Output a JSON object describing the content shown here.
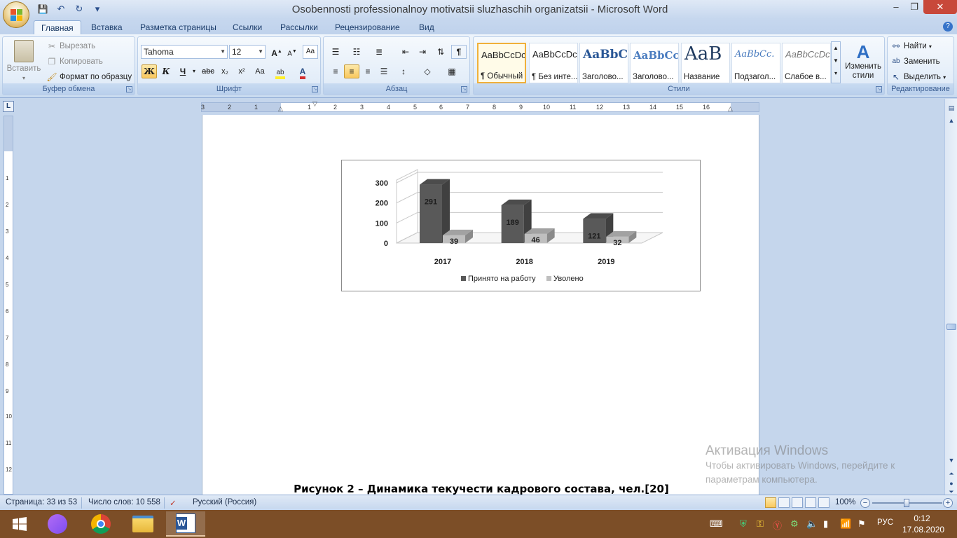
{
  "window": {
    "title": "Osobennosti professionalnoy motivatsii sluzhaschih organizatsii - Microsoft Word",
    "minimize": "‒",
    "maximize": "❐",
    "close": "✕"
  },
  "qat": {
    "save": "💾",
    "undo": "↶",
    "redo": "↻",
    "more": "▾"
  },
  "tabs": [
    "Главная",
    "Вставка",
    "Разметка страницы",
    "Ссылки",
    "Рассылки",
    "Рецензирование",
    "Вид"
  ],
  "clipboard": {
    "label": "Буфер обмена",
    "paste": "Вставить",
    "cut": "Вырезать",
    "copy": "Копировать",
    "format_painter": "Формат по образцу"
  },
  "font": {
    "label": "Шрифт",
    "family": "Tahoma",
    "size": "12",
    "bold": "Ж",
    "italic": "К",
    "underline": "Ч",
    "strike": "abc",
    "subscript": "x₂",
    "superscript": "x²",
    "case": "Aa"
  },
  "paragraph": {
    "label": "Абзац",
    "pilcrow": "¶"
  },
  "styles": {
    "label": "Стили",
    "items": [
      {
        "sample": "AaBbCcDc",
        "name": "¶ Обычный"
      },
      {
        "sample": "AaBbCcDc",
        "name": "¶ Без инте..."
      },
      {
        "sample": "AaBbC",
        "name": "Заголово..."
      },
      {
        "sample": "AaBbCc",
        "name": "Заголово..."
      },
      {
        "sample": "AaB",
        "name": "Название"
      },
      {
        "sample": "AaBbCc.",
        "name": "Подзагол..."
      },
      {
        "sample": "AaBbCcDc",
        "name": "Слабое в..."
      }
    ],
    "change": "Изменить стили"
  },
  "editing": {
    "label": "Редактирование",
    "find": "Найти",
    "replace": "Заменить",
    "select": "Выделить"
  },
  "ruler": {
    "corner": "L",
    "ticks": [
      "3",
      "2",
      "1",
      "1",
      "2",
      "3",
      "4",
      "5",
      "6",
      "7",
      "8",
      "9",
      "10",
      "11",
      "12",
      "13",
      "14",
      "15",
      "16"
    ],
    "vticks": [
      "1",
      "2",
      "3",
      "4",
      "5",
      "6",
      "7",
      "8",
      "9",
      "10",
      "11",
      "12"
    ]
  },
  "chart_data": {
    "type": "bar",
    "categories": [
      "2017",
      "2018",
      "2019"
    ],
    "series": [
      {
        "name": "Принято на работу",
        "values": [
          291,
          189,
          121
        ],
        "color": "#595959"
      },
      {
        "name": "Уволено",
        "values": [
          39,
          46,
          32
        ],
        "color": "#bfbfbf"
      }
    ],
    "ylim": [
      0,
      300
    ],
    "yticks": [
      "0",
      "100",
      "200",
      "300"
    ],
    "grid": true,
    "legend": "bottom",
    "style": "3d-column"
  },
  "caption": "Рисунок 2 – Динамика текучести кадрового состава, чел.[20]",
  "activation": {
    "title": "Активация Windows",
    "line1": "Чтобы активировать Windows, перейдите к",
    "line2": "параметрам компьютера."
  },
  "status": {
    "page": "Страница: 33 из 53",
    "words": "Число слов: 10 558",
    "language": "Русский (Россия)",
    "zoom": "100%",
    "zoom_level": 1.0
  },
  "taskbar": {
    "lang": "РУС",
    "time": "0:12",
    "date": "17.08.2020"
  }
}
